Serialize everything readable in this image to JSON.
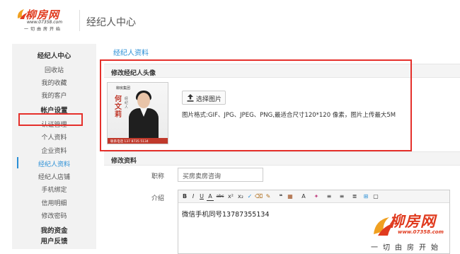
{
  "header": {
    "logo_cn": "柳房网",
    "logo_url": "www.07358.com",
    "logo_slogan": "一切由房开始",
    "title": "经纪人中心"
  },
  "sidebar": {
    "items": [
      {
        "label": "经纪人中心",
        "type": "head"
      },
      {
        "label": "回收站",
        "type": "item"
      },
      {
        "label": "我的收藏",
        "type": "item"
      },
      {
        "label": "我的客户",
        "type": "item"
      },
      {
        "label": "帐户设置",
        "type": "head"
      },
      {
        "label": "认证管理",
        "type": "item"
      },
      {
        "label": "个人资料",
        "type": "item"
      },
      {
        "label": "企业资料",
        "type": "item"
      },
      {
        "label": "经纪人资料",
        "type": "active"
      },
      {
        "label": "经纪人店铺",
        "type": "item"
      },
      {
        "label": "手机绑定",
        "type": "item"
      },
      {
        "label": "信用明细",
        "type": "item"
      },
      {
        "label": "修改密码",
        "type": "item"
      },
      {
        "label": "我的资金",
        "type": "head"
      },
      {
        "label": "用户反馈",
        "type": "head"
      }
    ]
  },
  "main": {
    "title": "经纪人资料",
    "avatar_section": {
      "label": "修改经纪人头像",
      "upload_button": "选择图片",
      "hint": "图片格式:GIF、JPG、JPEG、PNG,最适合尺寸120*120 像素，图片上传最大5M",
      "avatar_name": "何文莉",
      "avatar_sub": "经纪人",
      "avatar_brand": "柳房集团",
      "avatar_foot": "联系电话 137 8735 5134"
    },
    "profile_section": {
      "label": "修改资料",
      "title_label": "职称",
      "title_value": "买房卖房咨询",
      "intro_label": "介绍",
      "intro_value": "微信手机同号13787355134"
    }
  },
  "editor_toolbar": [
    "B",
    "I",
    "U",
    "A",
    "abc",
    "x²",
    "x₂",
    "✓",
    "⌫",
    "✎",
    "❝",
    "▦",
    "A",
    "✦",
    "≡",
    "≡",
    "≣",
    "⊞",
    "▢"
  ],
  "watermark": {
    "cn": "柳房网",
    "url": "www.07358.com",
    "slogan": "一切由房开始"
  },
  "colors": {
    "accent": "#2a8fd6",
    "highlight": "#e5302b",
    "brand": "#e03a1e"
  }
}
